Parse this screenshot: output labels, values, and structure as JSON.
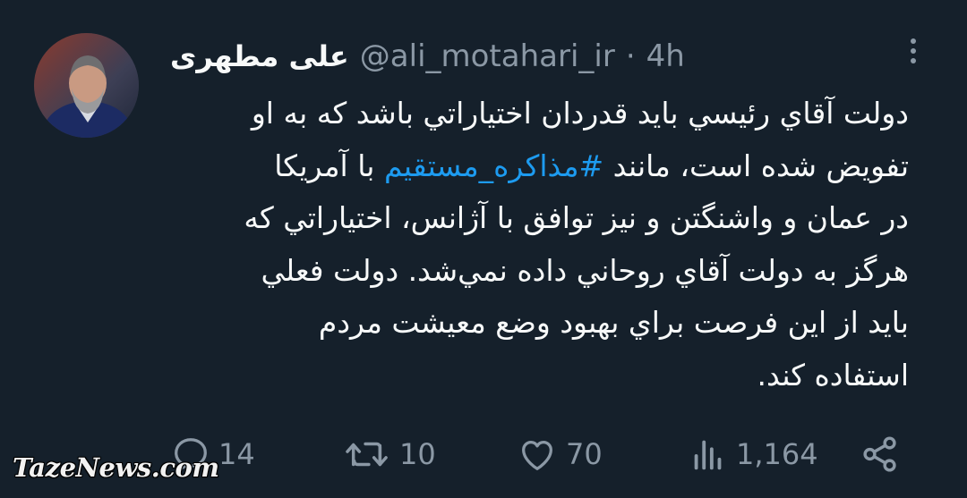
{
  "tweet": {
    "display_name": "علی مطهری",
    "handle": "@ali_motahari_ir",
    "separator": "·",
    "time": "4h",
    "lines": [
      "دولت آقاي رئيسي بايد قدردان اختياراتي باشد كه به او",
      "تفويض شده است، مانند ",
      " با آمريكا",
      "در عمان و واشنگتن و نيز توافق با آژانس، اختياراتي كه",
      "هرگز به دولت آقاي روحاني داده نمي‌شد. دولت فعلي",
      "بايد از اين فرصت براي بهبود وضع معيشت مردم",
      "استفاده كند."
    ],
    "hashtag": "#مذاكره_مستقيم"
  },
  "actions": {
    "replies": "14",
    "retweets": "10",
    "likes": "70",
    "views": "1,164"
  },
  "watermark": "TazeNews.com",
  "colors": {
    "background": "#15202b",
    "text": "#f7f9f9",
    "muted": "#8b98a5",
    "link": "#1d9bf0"
  },
  "icons": {
    "more": "more-dots-icon",
    "reply": "reply-icon",
    "retweet": "retweet-icon",
    "like": "heart-icon",
    "views": "views-bar-chart-icon",
    "share": "share-icon"
  }
}
